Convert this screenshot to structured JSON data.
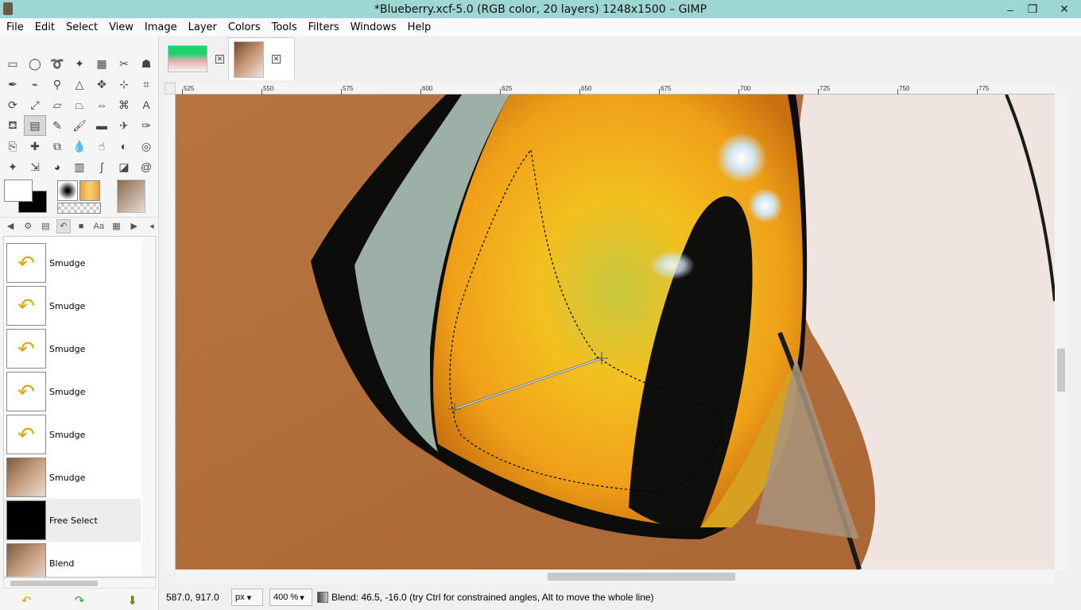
{
  "window": {
    "title": "*Blueberry.xcf-5.0 (RGB color, 20 layers) 1248x1500 – GIMP",
    "minimize": "‒",
    "restore": "❐",
    "close": "✕"
  },
  "menu": [
    "File",
    "Edit",
    "Select",
    "View",
    "Image",
    "Layer",
    "Colors",
    "Tools",
    "Filters",
    "Windows",
    "Help"
  ],
  "tools": [
    "rect-select-icon",
    "ellipse-select-icon",
    "free-select-icon",
    "fuzzy-select-icon",
    "select-by-color-icon",
    "scissors-icon",
    "foreground-select-icon",
    "paths-icon",
    "color-picker-icon",
    "zoom-icon",
    "measure-icon",
    "move-icon",
    "align-icon",
    "crop-icon",
    "rotate-icon",
    "scale-icon",
    "shear-icon",
    "perspective-icon",
    "flip-icon",
    "cage-icon",
    "text-icon",
    "bucket-fill-icon",
    "blend-icon",
    "pencil-icon",
    "paintbrush-icon",
    "eraser-icon",
    "airbrush-icon",
    "ink-icon",
    "clone-icon",
    "heal-icon",
    "perspective-clone-icon",
    "blur-icon",
    "smudge-icon",
    "dodge-burn-icon",
    "warp-icon",
    "mypaint-icon",
    "unified-transform-icon",
    "color-balance-icon",
    "levels-icon",
    "curves-icon",
    "threshold-icon",
    "spiral-icon"
  ],
  "active_tool_index": 22,
  "history": [
    {
      "label": "Smudge",
      "thumb": "smudge"
    },
    {
      "label": "Smudge",
      "thumb": "smudge"
    },
    {
      "label": "Smudge",
      "thumb": "smudge"
    },
    {
      "label": "Smudge",
      "thumb": "smudge"
    },
    {
      "label": "Smudge",
      "thumb": "smudge"
    },
    {
      "label": "Smudge",
      "thumb": "image"
    },
    {
      "label": "Free Select",
      "thumb": "black"
    },
    {
      "label": "Blend",
      "thumb": "image"
    }
  ],
  "rulers": {
    "h_labels": [
      "525",
      "550",
      "575",
      "600",
      "625",
      "650",
      "675",
      "700",
      "725",
      "750",
      "775"
    ]
  },
  "status": {
    "coords": "587.0, 917.0",
    "unit": "px",
    "zoom": "400 %",
    "message": "Blend: 46.5, -16.0 (try Ctrl for constrained angles, Alt to move the whole line)"
  },
  "colors": {
    "skin": "#b06d3a",
    "iris": "#f2b820",
    "pupil": "#0e0e0c",
    "sclera": "#9cb0a8",
    "background_light": "#efe4df"
  }
}
